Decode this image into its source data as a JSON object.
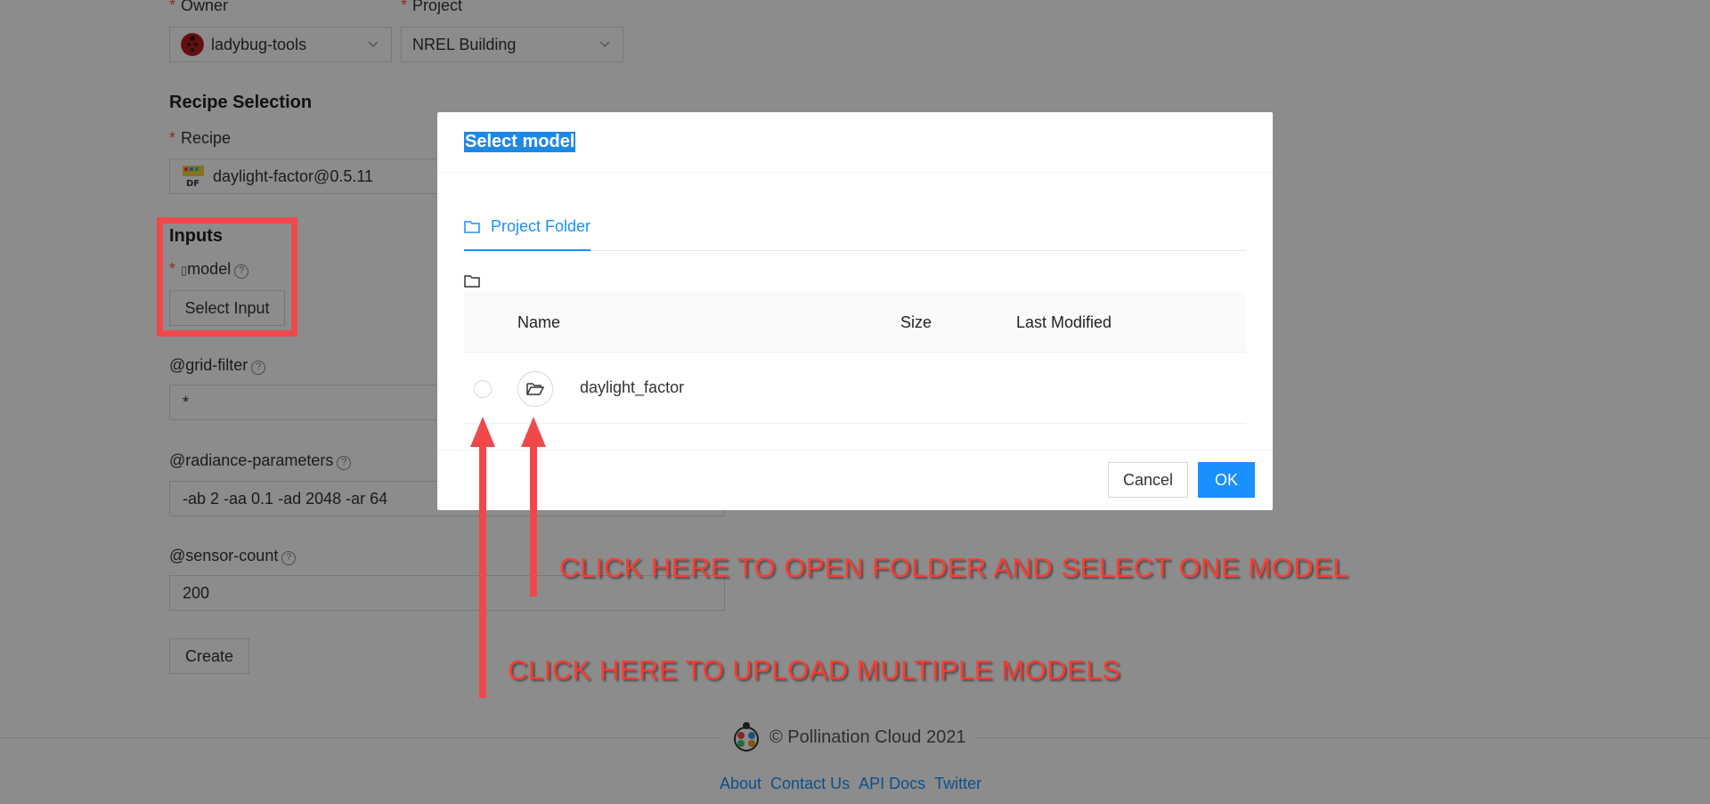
{
  "form": {
    "owner_label": "Owner",
    "owner_value": "ladybug-tools",
    "project_label": "Project",
    "project_value": "NREL Building",
    "recipe_section_title": "Recipe Selection",
    "recipe_label": "Recipe",
    "recipe_value": "daylight-factor@0.5.11",
    "inputs_section_title": "Inputs",
    "model_label": "model",
    "select_input_button": "Select Input",
    "grid_filter_label": "@grid-filter",
    "grid_filter_value": "*",
    "radiance_label": "@radiance-parameters",
    "radiance_value": "-ab 2 -aa 0.1 -ad 2048 -ar 64",
    "sensor_label": "@sensor-count",
    "sensor_value": "200",
    "create_button": "Create"
  },
  "footer": {
    "brand": "© Pollination Cloud 2021",
    "links": [
      "About",
      "Contact Us",
      "API Docs",
      "Twitter"
    ]
  },
  "modal": {
    "title": "Select model",
    "tab_label": "Project Folder",
    "columns": [
      "Name",
      "Size",
      "Last Modified"
    ],
    "rows": [
      {
        "name": "daylight_factor"
      }
    ],
    "cancel_label": "Cancel",
    "ok_label": "OK"
  },
  "annotations": {
    "open_folder": "CLICK HERE TO OPEN FOLDER AND SELECT ONE MODEL",
    "upload_multiple": "CLICK HERE TO UPLOAD MULTIPLE MODELS"
  },
  "colors": {
    "accent": "#1890ff",
    "required": "#ff4d4f",
    "annotation": "#ff3b30"
  }
}
